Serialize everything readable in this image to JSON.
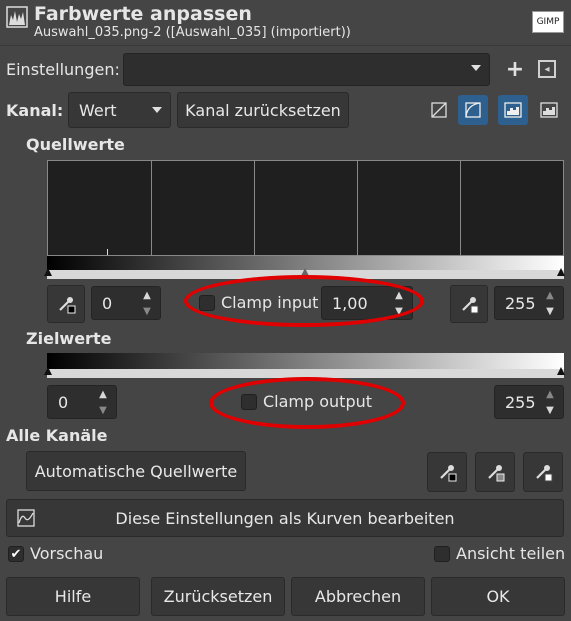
{
  "header": {
    "title": "Farbwerte anpassen",
    "subtitle": "Auswahl_035.png-2 ([Auswahl_035] (importiert))",
    "badge": "GIMP"
  },
  "settings": {
    "label": "Einstellungen:",
    "value": "",
    "add_symbol": "+",
    "menu_symbol": "◂"
  },
  "channel": {
    "label": "Kanal:",
    "value": "Wert",
    "reset_label": "Kanal zurücksetzen"
  },
  "source": {
    "heading": "Quellwerte",
    "low_value": "0",
    "gamma_value": "1,00",
    "high_value": "255",
    "clamp_input_label": "Clamp input",
    "clamp_input_checked": false
  },
  "target": {
    "heading": "Zielwerte",
    "low_value": "0",
    "high_value": "255",
    "clamp_output_label": "Clamp output",
    "clamp_output_checked": false
  },
  "all_channels": {
    "heading": "Alle Kanäle",
    "auto_label": "Automatische Quellwerte"
  },
  "curves_button": "Diese Einstellungen als Kurven bearbeiten",
  "preview": {
    "label": "Vorschau",
    "checked": true
  },
  "split_view": {
    "label": "Ansicht teilen",
    "checked": false
  },
  "footer": {
    "help": "Hilfe",
    "reset": "Zurücksetzen",
    "cancel": "Abbrechen",
    "ok": "OK"
  },
  "colors": {
    "background": "#454545",
    "accent_blue": "#2d5f8f",
    "highlight_ring": "#e10000"
  }
}
